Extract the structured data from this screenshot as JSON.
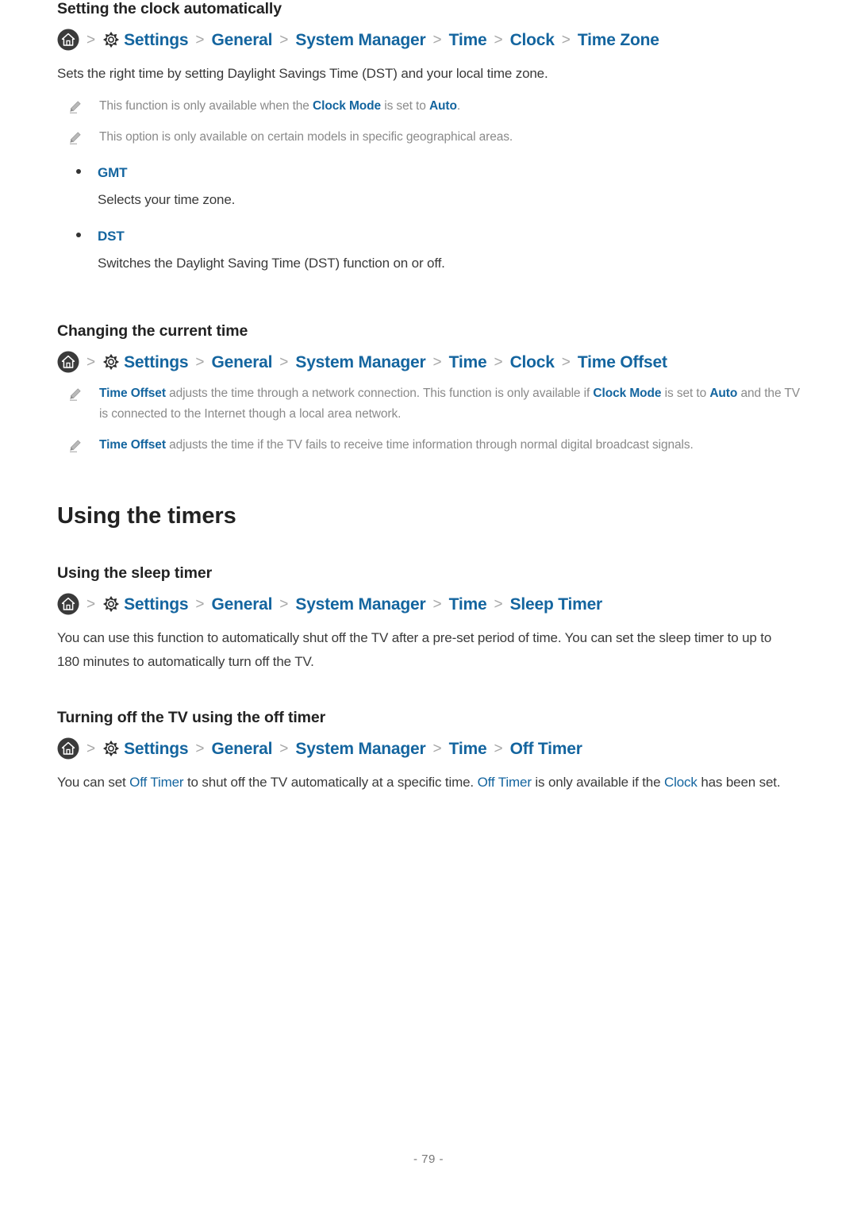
{
  "document": {
    "page_number": "- 79 -"
  },
  "icons": {
    "home": "home-icon",
    "gear": "gear-icon",
    "pencil": "pencil-note-icon",
    "chevron": "chevron-right-icon"
  },
  "colors": {
    "link_blue": "#14659f",
    "body_text": "#3a3a3a",
    "note_text": "#8a8a8a",
    "heading": "#222222",
    "separator": "#a7a7a7"
  },
  "separator": ">",
  "sections": [
    {
      "heading": "Setting the clock automatically",
      "breadcrumb": [
        "Settings",
        "General",
        "System Manager",
        "Time",
        "Clock",
        "Time Zone"
      ],
      "paragraph": {
        "prefix": "Sets the right time by setting Daylight Savings Time (DST) and your local time zone.",
        "full": "Sets the right time by setting Daylight Savings Time (DST) and your local time zone."
      },
      "notes": [
        {
          "p1": "This function is only available when the ",
          "t1": "Clock Mode",
          "p2": " is set to ",
          "t2": "Auto",
          "p3": "."
        },
        {
          "p1": "This option is only available on certain models in specific geographical areas.",
          "t1": "",
          "p2": "",
          "t2": "",
          "p3": ""
        }
      ],
      "bullets": [
        {
          "label": "GMT",
          "description": "Selects your time zone."
        },
        {
          "label": "DST",
          "description": "Switches the Daylight Saving Time (DST) function on or off."
        }
      ]
    },
    {
      "heading": "Changing the current time",
      "breadcrumb": [
        "Settings",
        "General",
        "System Manager",
        "Time",
        "Clock",
        "Time Offset"
      ],
      "notes": [
        {
          "t1": "Time Offset",
          "p1": " adjusts the time through a network connection. This function is only available if ",
          "t2": "Clock Mode",
          "p2": " is set to ",
          "t3": "Auto",
          "p3": " and the TV is connected to the Internet though a local area network."
        },
        {
          "t1": "Time Offset",
          "p1": " adjusts the time if the TV fails to receive time information through normal digital broadcast signals.",
          "t2": "",
          "p2": "",
          "t3": "",
          "p3": ""
        }
      ]
    }
  ],
  "main_section": {
    "title": "Using the timers",
    "subsections": [
      {
        "heading": "Using the sleep timer",
        "breadcrumb": [
          "Settings",
          "General",
          "System Manager",
          "Time",
          "Sleep Timer"
        ],
        "paragraph": "You can use this function to automatically shut off the TV after a pre-set period of time. You can set the sleep timer to up to 180 minutes to automatically turn off the TV."
      },
      {
        "heading": "Turning off the TV using the off timer",
        "breadcrumb": [
          "Settings",
          "General",
          "System Manager",
          "Time",
          "Off Timer"
        ],
        "paragraph": {
          "p1": "You can set ",
          "t1": "Off Timer",
          "p2": " to shut off the TV automatically at a specific time. ",
          "t2": "Off Timer",
          "p3": " is only available if the ",
          "t3": "Clock",
          "p4": " has been set."
        }
      }
    ]
  }
}
